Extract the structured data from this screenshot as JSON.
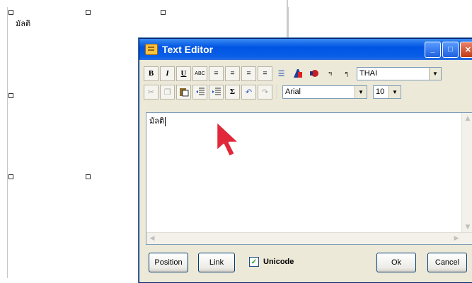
{
  "canvas": {
    "label_text": "มัลติ"
  },
  "dialog": {
    "title": "Text Editor",
    "title_buttons": {
      "minimize": "_",
      "maximize": "□",
      "close": "✕"
    },
    "toolbar1": {
      "bold": "B",
      "italic": "I",
      "underline": "U",
      "spell": "ABC",
      "align_left": "≡",
      "align_center": "≡",
      "align_right": "≡",
      "justify": "≡",
      "bullets": "☰",
      "thai_icon_1": "ฯ",
      "thai_icon_2": "ๆ",
      "language_value": "THAI"
    },
    "toolbar2": {
      "sigma": "Σ",
      "undo": "↶",
      "redo": "↷",
      "font_value": "Arial",
      "size_value": "10"
    },
    "editor_text": "มัลติ",
    "buttons": {
      "position": "Position",
      "link": "Link",
      "ok": "Ok",
      "cancel": "Cancel"
    },
    "unicode_checkbox": {
      "label": "Unicode",
      "checked": true,
      "check_mark": "✓"
    }
  },
  "colors": {
    "titlebar": "#0054e3",
    "dialog_bg": "#ece9d8",
    "pointer": "#e0283a"
  }
}
